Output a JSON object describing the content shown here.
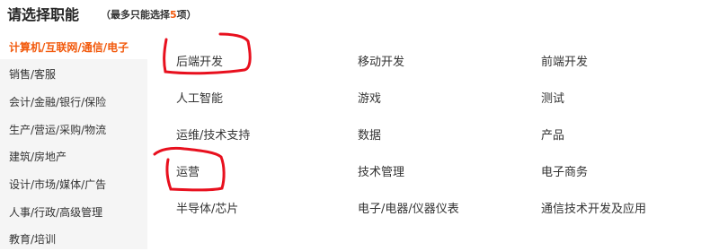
{
  "header": {
    "title": "请选择职能",
    "note_prefix": "（最多只能选择",
    "note_count": "5",
    "note_suffix": "项）"
  },
  "sidebar": {
    "items": [
      {
        "label": "计算机/互联网/通信/电子",
        "active": true
      },
      {
        "label": "销售/客服",
        "active": false
      },
      {
        "label": "会计/金融/银行/保险",
        "active": false
      },
      {
        "label": "生产/营运/采购/物流",
        "active": false
      },
      {
        "label": "建筑/房地产",
        "active": false
      },
      {
        "label": "设计/市场/媒体/广告",
        "active": false
      },
      {
        "label": "人事/行政/高级管理",
        "active": false
      },
      {
        "label": "教育/培训",
        "active": false
      }
    ]
  },
  "options": {
    "rows": [
      [
        "后端开发",
        "移动开发",
        "前端开发"
      ],
      [
        "人工智能",
        "游戏",
        "测试"
      ],
      [
        "运维/技术支持",
        "数据",
        "产品"
      ],
      [
        "运营",
        "技术管理",
        "电子商务"
      ],
      [
        "半导体/芯片",
        "电子/电器/仪器仪表",
        "通信技术开发及应用"
      ]
    ]
  },
  "colors": {
    "accent": "#f25a0d",
    "annotation": "#e8101e",
    "sidebar_bg": "#f5f5f5"
  }
}
